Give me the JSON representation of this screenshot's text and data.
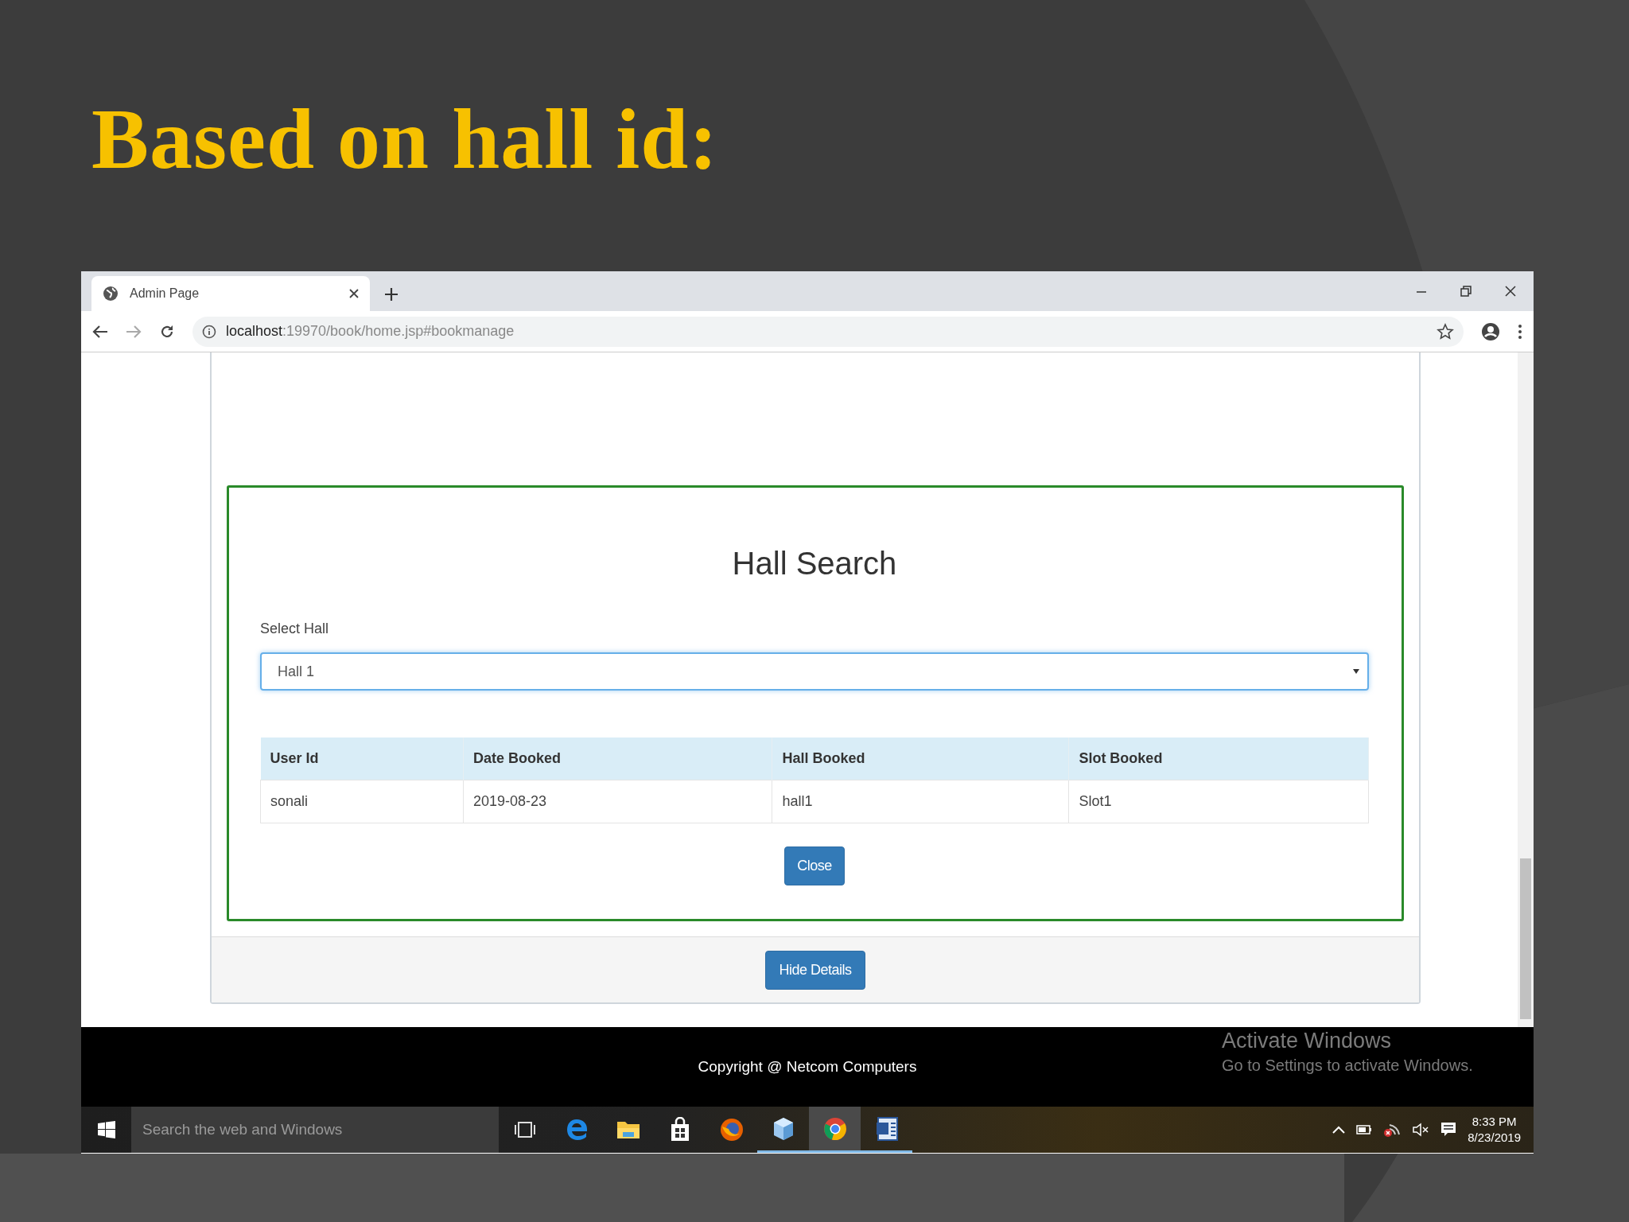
{
  "slide": {
    "title": "Based on hall id:"
  },
  "browser": {
    "tab_title": "Admin Page",
    "url_host": "localhost",
    "url_rest": ":19970/book/home.jsp#bookmanage"
  },
  "panel": {
    "heading": "Hall Search",
    "select_label": "Select Hall",
    "select_value": "Hall 1",
    "table": {
      "columns": [
        "User Id",
        "Date Booked",
        "Hall Booked",
        "Slot Booked"
      ],
      "rows": [
        [
          "sonali",
          "2019-08-23",
          "hall1",
          "Slot1"
        ]
      ]
    },
    "close_button": "Close"
  },
  "card_footer": {
    "button": "Hide Details"
  },
  "footer": {
    "text": "Copyright @ Netcom Computers"
  },
  "activation_notice": {
    "title": "Activate Windows",
    "text": "Go to Settings to activate Windows."
  },
  "taskbar": {
    "search_placeholder": "Search the web and Windows",
    "apps": [
      {
        "kind": "taskview",
        "open": false,
        "selected": false
      },
      {
        "kind": "edge",
        "open": false,
        "selected": false
      },
      {
        "kind": "folder",
        "open": false,
        "selected": false
      },
      {
        "kind": "store",
        "open": false,
        "selected": false
      },
      {
        "kind": "firefox",
        "open": false,
        "selected": false
      },
      {
        "kind": "cube",
        "open": true,
        "selected": false
      },
      {
        "kind": "chrome",
        "open": true,
        "selected": true
      },
      {
        "kind": "word",
        "open": true,
        "selected": false
      }
    ],
    "time": "8:33 PM",
    "date": "8/23/2019"
  }
}
